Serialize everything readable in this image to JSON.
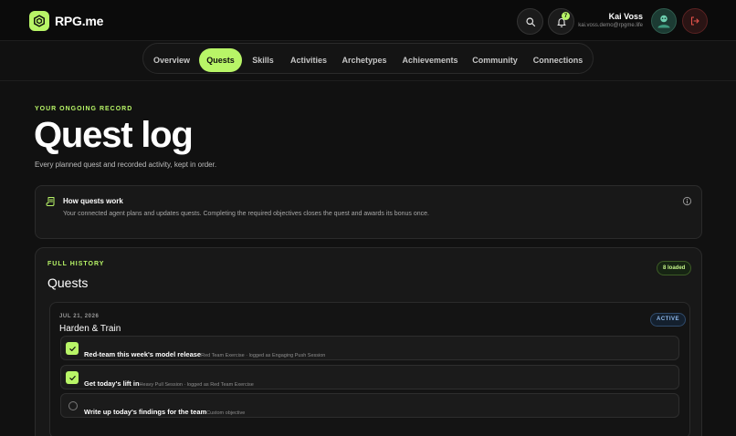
{
  "brand": {
    "name": "RPG.me"
  },
  "header": {
    "notification_count": "7",
    "user_name": "Kai Voss",
    "user_email": "kai.voss.demo@rpgme.life"
  },
  "nav": {
    "tabs": [
      {
        "label": "Overview",
        "active": false
      },
      {
        "label": "Quests",
        "active": true
      },
      {
        "label": "Skills",
        "active": false
      },
      {
        "label": "Activities",
        "active": false
      },
      {
        "label": "Archetypes",
        "active": false
      },
      {
        "label": "Achievements",
        "active": false
      },
      {
        "label": "Community",
        "active": false
      },
      {
        "label": "Connections",
        "active": false
      }
    ]
  },
  "page": {
    "eyebrow": "YOUR ONGOING RECORD",
    "title": "Quest log",
    "subtitle": "Every planned quest and recorded activity, kept in order."
  },
  "how_it_works": {
    "title": "How quests work",
    "body": "Your connected agent plans and updates quests. Completing the required objectives closes the quest and awards its bonus once."
  },
  "history": {
    "eyebrow": "FULL HISTORY",
    "title": "Quests",
    "loaded_badge": "8 loaded",
    "quests": [
      {
        "date": "JUL 21, 2026",
        "name": "Harden & Train",
        "status": "ACTIVE",
        "objectives": [
          {
            "title": "Red-team this week's model release",
            "meta": "Red Team Exercise · logged as Engaging Push Session",
            "done": true
          },
          {
            "title": "Get today's lift in",
            "meta": "Heavy Pull Session · logged as Red Team Exercise",
            "done": true
          },
          {
            "title": "Write up today's findings for the team",
            "meta": "Custom objective",
            "done": false
          }
        ]
      }
    ]
  },
  "colors": {
    "accent": "#b8f567",
    "background": "#111111",
    "card": "#181818",
    "active_status": "#8fb8ea",
    "logout": "#e5534b"
  },
  "icons": {
    "logo": "hexagon-logo-icon",
    "search": "search-icon",
    "notifications": "bell-icon",
    "logout": "logout-icon",
    "how_it_works": "scroll-icon",
    "info": "info-icon",
    "check": "check-icon"
  }
}
